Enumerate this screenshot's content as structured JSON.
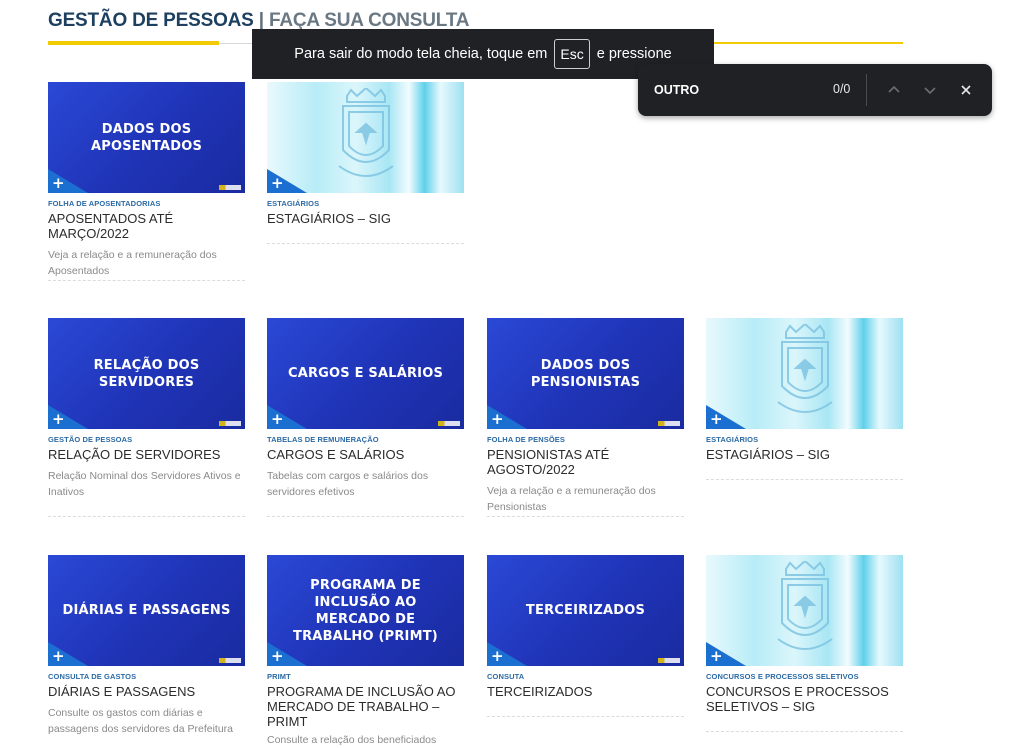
{
  "header": {
    "title_bold": "GESTÃO DE PESSOAS",
    "separator": "|",
    "title_light": "FAÇA SUA CONSULTA",
    "accent_color": "#f2cb05"
  },
  "fullscreen_notice": {
    "before": "Para sair do modo tela cheia, toque em",
    "key": "Esc",
    "after": "e pressione"
  },
  "find_bar": {
    "query": "OUTRO",
    "count": "0/0",
    "prev_icon": "chevron-up-icon",
    "next_icon": "chevron-down-icon",
    "close_icon": "close-icon"
  },
  "cards": [
    {
      "thumb_text": "DADOS DOS APOSENTADOS",
      "category": "FOLHA DE APOSENTADORIAS",
      "title": "APOSENTADOS ATÉ MARÇO/2022",
      "desc": "Veja a relação e a remuneração dos Aposentados"
    },
    {
      "thumb_text": "",
      "category": "ESTAGIÁRIOS",
      "title": "ESTAGIÁRIOS – SIG",
      "desc": ""
    },
    {
      "thumb_text": "RELAÇÃO DOS SERVIDORES",
      "category": "GESTÃO DE PESSOAS",
      "title": "RELAÇÃO DE SERVIDORES",
      "desc": "Relação Nominal dos Servidores Ativos e Inativos"
    },
    {
      "thumb_text": "CARGOS E SALÁRIOS",
      "category": "TABELAS DE REMUNERAÇÃO",
      "title": "CARGOS E SALÁRIOS",
      "desc": "Tabelas com cargos e salários dos servidores efetivos"
    },
    {
      "thumb_text": "DADOS DOS PENSIONISTAS",
      "category": "FOLHA DE PENSÕES",
      "title": "PENSIONISTAS ATÉ AGOSTO/2022",
      "desc": "Veja a relação e a remuneração dos Pensionistas"
    },
    {
      "thumb_text": "",
      "category": "ESTAGIÁRIOS",
      "title": "ESTAGIÁRIOS – SIG",
      "desc": ""
    },
    {
      "thumb_text": "DIÁRIAS E PASSAGENS",
      "category": "CONSULTA DE GASTOS",
      "title": "DIÁRIAS E PASSAGENS",
      "desc": "Consulte os gastos com diárias e passagens dos servidores da Prefeitura"
    },
    {
      "thumb_text": "PROGRAMA DE INCLUSÃO AO MERCADO DE TRABALHO (PRIMT)",
      "category": "PRIMT",
      "title": "PROGRAMA DE INCLUSÃO AO MERCADO DE TRABALHO – PRIMT",
      "desc": "Consulte a relação dos beneficiados"
    },
    {
      "thumb_text": "TERCEIRIZADOS",
      "category": "CONSUTA",
      "title": "TERCEIRIZADOS",
      "desc": ""
    },
    {
      "thumb_text": "",
      "category": "CONCURSOS E PROCESSOS SELETIVOS",
      "title": "CONCURSOS E PROCESSOS SELETIVOS – SIG",
      "desc": ""
    }
  ]
}
